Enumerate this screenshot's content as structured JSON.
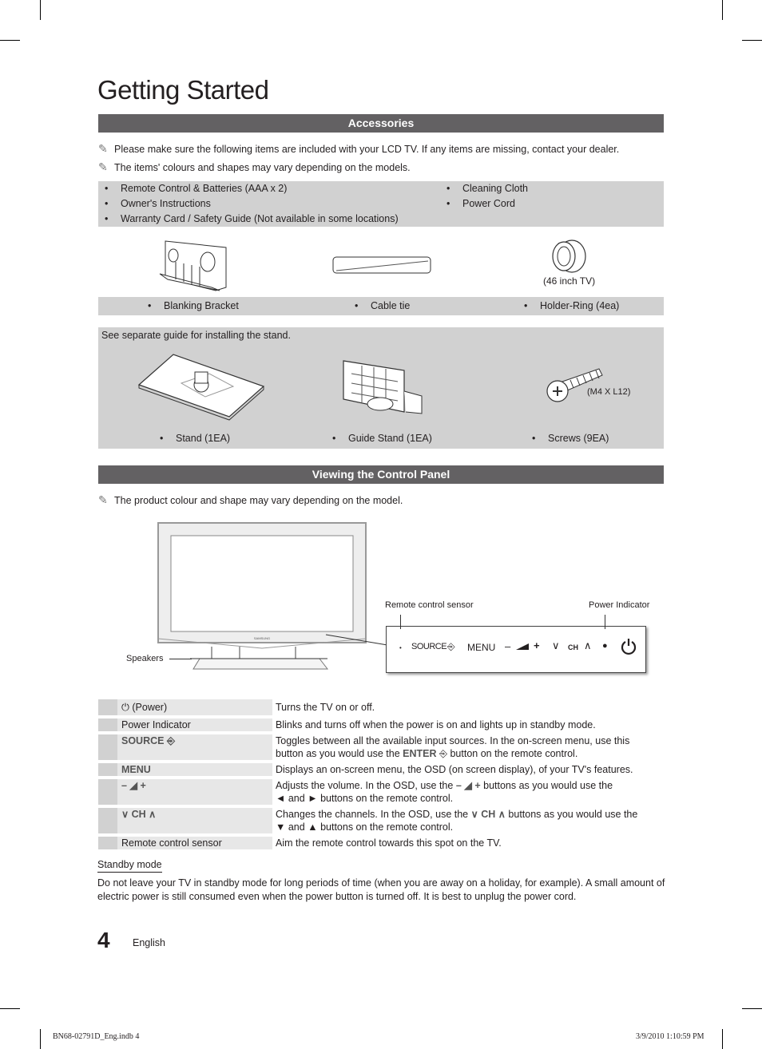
{
  "page_title": "Getting Started",
  "accessories": {
    "heading": "Accessories",
    "notes": [
      "Please make sure the following items are included with your LCD TV. If any items are missing, contact your dealer.",
      "The items' colours and shapes may vary depending on the models."
    ],
    "list_left": [
      "Remote Control & Batteries (AAA x 2)",
      "Owner's Instructions",
      "Warranty Card / Safety Guide (Not available in some locations)"
    ],
    "list_right": [
      "Cleaning Cloth",
      "Power Cord"
    ],
    "row1": {
      "items": [
        "Blanking Bracket",
        "Cable tie",
        "Holder-Ring (4ea)"
      ],
      "holder_caption": "(46 inch TV)"
    },
    "stand_box": {
      "note": "See separate guide for installing the stand.",
      "items": [
        "Stand (1EA)",
        "Guide Stand (1EA)",
        "Screws (9EA)"
      ],
      "screw_caption": "(M4 X L12)"
    }
  },
  "control_panel": {
    "heading": "Viewing the Control Panel",
    "note": "The product colour and shape may vary depending on the model.",
    "diagram": {
      "callout_remote_sensor": "Remote control sensor",
      "callout_power_indicator": "Power Indicator",
      "callout_speakers": "Speakers",
      "brand": "SAMSUNG",
      "panel_source": "SOURCE",
      "panel_menu": "MENU",
      "panel_ch": "CH"
    },
    "table": [
      {
        "label": "(Power)",
        "desc": [
          "Turns the TV on or off."
        ]
      },
      {
        "label": "Power Indicator",
        "desc": [
          "Blinks and turns off when the power is on and lights up in standby mode."
        ]
      },
      {
        "label": "SOURCE",
        "desc": [
          "Toggles between all the available input sources. In the on-screen menu, use this",
          "button as you would use the",
          "ENTER",
          "button on the remote control."
        ]
      },
      {
        "label": "MENU",
        "desc": [
          "Displays an on-screen menu, the OSD (on screen display), of your TV's features."
        ]
      },
      {
        "label": "",
        "desc": [
          "Adjusts the volume. In the OSD, use the",
          "buttons as you would use the",
          "and",
          "buttons on the remote control."
        ]
      },
      {
        "label": "CH",
        "desc": [
          "Changes the channels. In the OSD, use the",
          "buttons as you would use the",
          "and",
          "buttons on the remote control."
        ]
      },
      {
        "label": "Remote control sensor",
        "desc": [
          "Aim the remote control towards this spot on the TV."
        ]
      }
    ]
  },
  "standby": {
    "heading": "Standby mode",
    "text": "Do not leave your TV in standby mode for long periods of time (when you are away on a holiday, for example). A small amount of electric power is still consumed even when the power button is turned off. It is best to unplug the power cord."
  },
  "footer": {
    "page_number": "4",
    "language": "English",
    "slug_file": "BN68-02791D_Eng.indb   4",
    "slug_date": "3/9/2010   1:10:59 PM"
  }
}
